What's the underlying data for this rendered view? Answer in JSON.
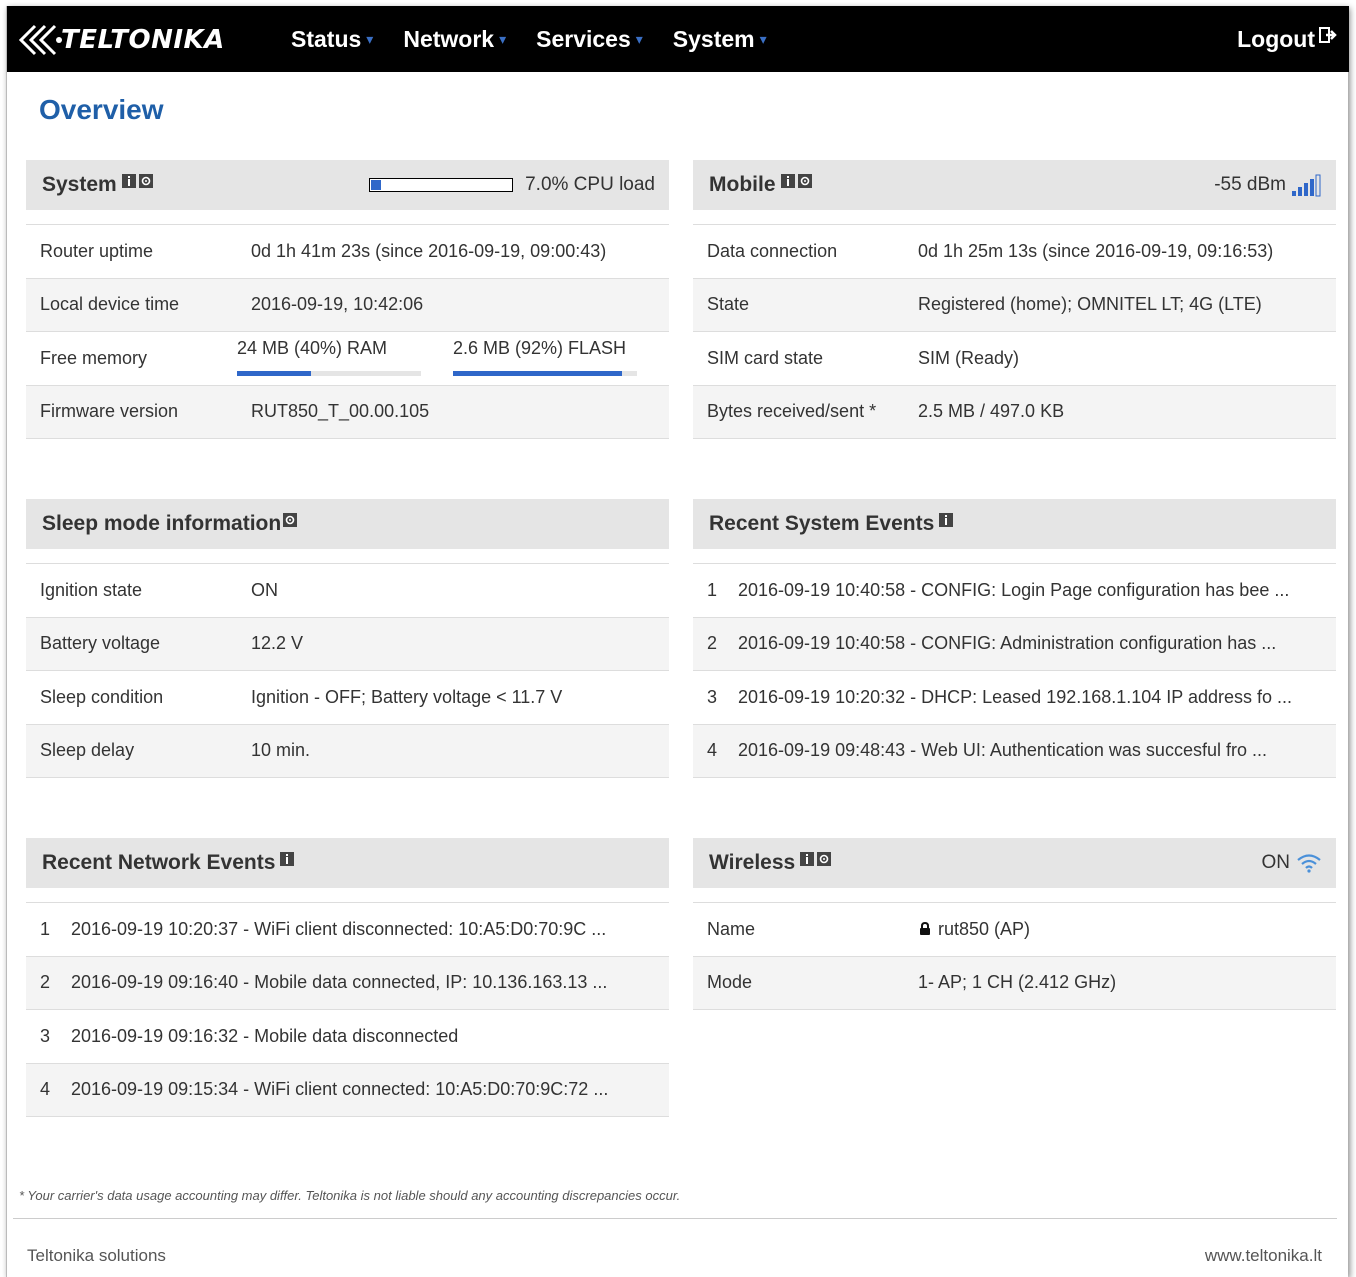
{
  "brand": {
    "name": "TELTONIKA"
  },
  "nav": {
    "items": [
      {
        "label": "Status"
      },
      {
        "label": "Network"
      },
      {
        "label": "Services"
      },
      {
        "label": "System"
      }
    ],
    "logout_label": "Logout"
  },
  "page": {
    "title": "Overview"
  },
  "system_panel": {
    "title": "System",
    "cpu_load_text": "7.0% CPU load",
    "cpu_load_fraction": 0.07,
    "rows": [
      {
        "label": "Router uptime",
        "value": "0d 1h 41m 23s (since 2016-09-19, 09:00:43)"
      },
      {
        "label": "Local device time",
        "value": "2016-09-19, 10:42:06"
      },
      {
        "label": "Free memory",
        "ram_text": "24 MB (40%) RAM",
        "ram_fraction": 0.4,
        "flash_text": "2.6 MB (92%) FLASH",
        "flash_fraction": 0.92
      },
      {
        "label": "Firmware version",
        "value": "RUT850_T_00.00.105"
      }
    ]
  },
  "mobile_panel": {
    "title": "Mobile",
    "signal_text": "-55 dBm",
    "rows": [
      {
        "label": "Data connection",
        "value": "0d 1h 25m 13s (since 2016-09-19, 09:16:53)"
      },
      {
        "label": "State",
        "value": "Registered (home); OMNITEL LT; 4G (LTE)"
      },
      {
        "label": "SIM card state",
        "value": "SIM (Ready)"
      },
      {
        "label": "Bytes received/sent *",
        "value": "2.5 MB / 497.0 KB"
      }
    ]
  },
  "sleep_panel": {
    "title": "Sleep mode information",
    "rows": [
      {
        "label": "Ignition state",
        "value": "ON"
      },
      {
        "label": "Battery voltage",
        "value": "12.2 V"
      },
      {
        "label": "Sleep condition",
        "value": "Ignition - OFF; Battery voltage < 11.7 V"
      },
      {
        "label": "Sleep delay",
        "value": "10 min."
      }
    ]
  },
  "system_events_panel": {
    "title": "Recent System Events",
    "rows": [
      {
        "num": "1",
        "text": "2016-09-19 10:40:58 - CONFIG: Login Page configuration has bee ..."
      },
      {
        "num": "2",
        "text": "2016-09-19 10:40:58 - CONFIG: Administration configuration has ..."
      },
      {
        "num": "3",
        "text": "2016-09-19 10:20:32 - DHCP: Leased 192.168.1.104 IP address fo ..."
      },
      {
        "num": "4",
        "text": "2016-09-19 09:48:43 - Web UI: Authentication was succesful fro ..."
      }
    ]
  },
  "network_events_panel": {
    "title": "Recent Network Events",
    "rows": [
      {
        "num": "1",
        "text": "2016-09-19 10:20:37 - WiFi client disconnected: 10:A5:D0:70:9C ..."
      },
      {
        "num": "2",
        "text": "2016-09-19 09:16:40 - Mobile data connected, IP: 10.136.163.13 ..."
      },
      {
        "num": "3",
        "text": "2016-09-19 09:16:32 - Mobile data disconnected"
      },
      {
        "num": "4",
        "text": "2016-09-19 09:15:34 - WiFi client connected: 10:A5:D0:70:9C:72 ..."
      }
    ]
  },
  "wireless_panel": {
    "title": "Wireless",
    "status_text": "ON",
    "rows": [
      {
        "label": "Name",
        "value": "rut850 (AP)",
        "icon": "lock-icon"
      },
      {
        "label": "Mode",
        "value": "1- AP; 1 CH (2.412 GHz)"
      }
    ]
  },
  "footer": {
    "note": "* Your carrier's data usage accounting may differ. Teltonika is not liable should any accounting discrepancies occur.",
    "left": "Teltonika solutions",
    "right": "www.teltonika.lt"
  },
  "colors": {
    "accent": "#2f67c9",
    "title": "#1f5fa8",
    "topbar": "#000000",
    "panel_head": "#e5e5e5"
  }
}
